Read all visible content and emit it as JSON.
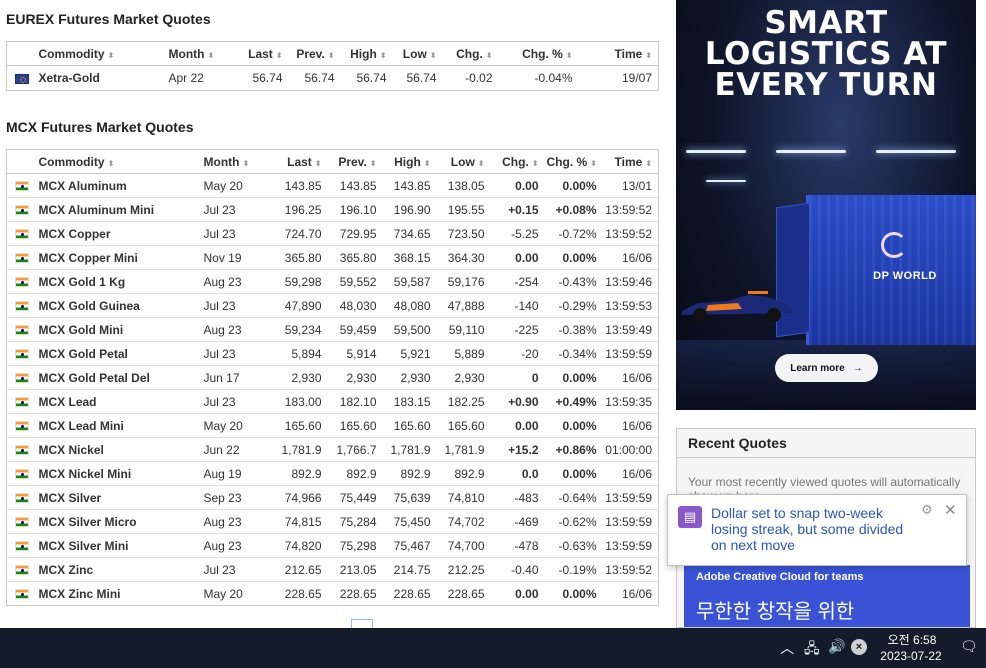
{
  "eurex": {
    "title": "EUREX Futures Market Quotes",
    "headers": [
      "Commodity",
      "Month",
      "Last",
      "Prev.",
      "High",
      "Low",
      "Chg.",
      "Chg. %",
      "Time"
    ],
    "rows": [
      {
        "name": "Xetra-Gold",
        "month": "Apr 22",
        "last": "56.74",
        "prev": "56.74",
        "high": "56.74",
        "low": "56.74",
        "chg": "-0.02",
        "chgp": "-0.04%",
        "time": "19/07",
        "dir": "down"
      }
    ]
  },
  "mcx": {
    "title": "MCX Futures Market Quotes",
    "headers": [
      "Commodity",
      "Month",
      "Last",
      "Prev.",
      "High",
      "Low",
      "Chg.",
      "Chg. %",
      "Time"
    ],
    "rows": [
      {
        "name": "MCX Aluminum",
        "month": "May 20",
        "last": "143.85",
        "prev": "143.85",
        "high": "143.85",
        "low": "138.05",
        "chg": "0.00",
        "chgp": "0.00%",
        "time": "13/01",
        "dir": "zero"
      },
      {
        "name": "MCX Aluminum Mini",
        "month": "Jul 23",
        "last": "196.25",
        "prev": "196.10",
        "high": "196.90",
        "low": "195.55",
        "chg": "+0.15",
        "chgp": "+0.08%",
        "time": "13:59:52",
        "dir": "up"
      },
      {
        "name": "MCX Copper",
        "month": "Jul 23",
        "last": "724.70",
        "prev": "729.95",
        "high": "734.65",
        "low": "723.50",
        "chg": "-5.25",
        "chgp": "-0.72%",
        "time": "13:59:52",
        "dir": "down"
      },
      {
        "name": "MCX Copper Mini",
        "month": "Nov 19",
        "last": "365.80",
        "prev": "365.80",
        "high": "368.15",
        "low": "364.30",
        "chg": "0.00",
        "chgp": "0.00%",
        "time": "16/06",
        "dir": "zero"
      },
      {
        "name": "MCX Gold 1 Kg",
        "month": "Aug 23",
        "last": "59,298",
        "prev": "59,552",
        "high": "59,587",
        "low": "59,176",
        "chg": "-254",
        "chgp": "-0.43%",
        "time": "13:59:46",
        "dir": "down"
      },
      {
        "name": "MCX Gold Guinea",
        "month": "Jul 23",
        "last": "47,890",
        "prev": "48,030",
        "high": "48,080",
        "low": "47,888",
        "chg": "-140",
        "chgp": "-0.29%",
        "time": "13:59:53",
        "dir": "down"
      },
      {
        "name": "MCX Gold Mini",
        "month": "Aug 23",
        "last": "59,234",
        "prev": "59,459",
        "high": "59,500",
        "low": "59,110",
        "chg": "-225",
        "chgp": "-0.38%",
        "time": "13:59:49",
        "dir": "down"
      },
      {
        "name": "MCX Gold Petal",
        "month": "Jul 23",
        "last": "5,894",
        "prev": "5,914",
        "high": "5,921",
        "low": "5,889",
        "chg": "-20",
        "chgp": "-0.34%",
        "time": "13:59:59",
        "dir": "down"
      },
      {
        "name": "MCX Gold Petal Del",
        "month": "Jun 17",
        "last": "2,930",
        "prev": "2,930",
        "high": "2,930",
        "low": "2,930",
        "chg": "0",
        "chgp": "0.00%",
        "time": "16/06",
        "dir": "zero"
      },
      {
        "name": "MCX Lead",
        "month": "Jul 23",
        "last": "183.00",
        "prev": "182.10",
        "high": "183.15",
        "low": "182.25",
        "chg": "+0.90",
        "chgp": "+0.49%",
        "time": "13:59:35",
        "dir": "up"
      },
      {
        "name": "MCX Lead Mini",
        "month": "May 20",
        "last": "165.60",
        "prev": "165.60",
        "high": "165.60",
        "low": "165.60",
        "chg": "0.00",
        "chgp": "0.00%",
        "time": "16/06",
        "dir": "zero"
      },
      {
        "name": "MCX Nickel",
        "month": "Jun 22",
        "last": "1,781.9",
        "prev": "1,766.7",
        "high": "1,781.9",
        "low": "1,781.9",
        "chg": "+15.2",
        "chgp": "+0.86%",
        "time": "01:00:00",
        "dir": "up"
      },
      {
        "name": "MCX Nickel Mini",
        "month": "Aug 19",
        "last": "892.9",
        "prev": "892.9",
        "high": "892.9",
        "low": "892.9",
        "chg": "0.0",
        "chgp": "0.00%",
        "time": "16/06",
        "dir": "zero"
      },
      {
        "name": "MCX Silver",
        "month": "Sep 23",
        "last": "74,966",
        "prev": "75,449",
        "high": "75,639",
        "low": "74,810",
        "chg": "-483",
        "chgp": "-0.64%",
        "time": "13:59:59",
        "dir": "down"
      },
      {
        "name": "MCX Silver Micro",
        "month": "Aug 23",
        "last": "74,815",
        "prev": "75,284",
        "high": "75,450",
        "low": "74,702",
        "chg": "-469",
        "chgp": "-0.62%",
        "time": "13:59:59",
        "dir": "down"
      },
      {
        "name": "MCX Silver Mini",
        "month": "Aug 23",
        "last": "74,820",
        "prev": "75,298",
        "high": "75,467",
        "low": "74,700",
        "chg": "-478",
        "chgp": "-0.63%",
        "time": "13:59:59",
        "dir": "down"
      },
      {
        "name": "MCX Zinc",
        "month": "Jul 23",
        "last": "212.65",
        "prev": "213.05",
        "high": "214.75",
        "low": "212.25",
        "chg": "-0.40",
        "chgp": "-0.19%",
        "time": "13:59:52",
        "dir": "down"
      },
      {
        "name": "MCX Zinc Mini",
        "month": "May 20",
        "last": "228.65",
        "prev": "228.65",
        "high": "228.65",
        "low": "228.65",
        "chg": "0.00",
        "chgp": "0.00%",
        "time": "16/06",
        "dir": "zero"
      }
    ]
  },
  "colors": {
    "up": "#1a9c2a",
    "down": "#e0191c",
    "link": "#1a4e8c"
  },
  "ad": {
    "headline": [
      "SMART",
      "LOGISTICS AT",
      "EVERY TURN"
    ],
    "logo": "DP WORLD",
    "cta": "Learn more",
    "cta_icon": "arrow-right-icon"
  },
  "recent_quotes": {
    "title": "Recent Quotes",
    "text": "Your most recently viewed quotes will automatically show up here."
  },
  "adobe_ad": {
    "name": "Adobe Creative Cloud for teams",
    "slogan": "무한한 창작을 위한"
  },
  "notification": {
    "text": "Dollar set to snap two-week losing streak, but some divided on next move",
    "icon": "news-icon"
  },
  "taskbar": {
    "time": "오전 6:58",
    "date": "2023-07-22"
  }
}
